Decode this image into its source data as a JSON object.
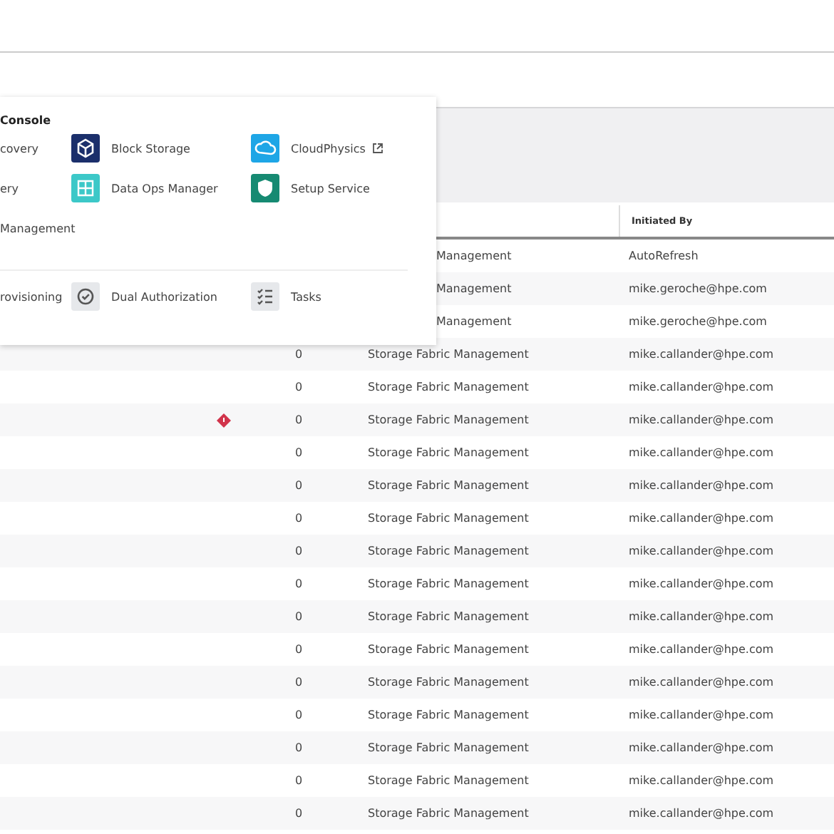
{
  "table": {
    "columns": [
      {
        "label": "Initiated By"
      }
    ],
    "rows": [
      {
        "module": "Management",
        "initiated_by": "AutoRefresh"
      },
      {
        "module": "Management",
        "initiated_by": "mike.geroche@hpe.com"
      },
      {
        "module": "Management",
        "initiated_by": "mike.geroche@hpe.com"
      },
      {
        "count": "0",
        "module": "Storage Fabric Management",
        "initiated_by": "mike.callander@hpe.com"
      },
      {
        "count": "0",
        "module": "Storage Fabric Management",
        "initiated_by": "mike.callander@hpe.com"
      },
      {
        "count": "0",
        "module": "Storage Fabric Management",
        "initiated_by": "mike.callander@hpe.com",
        "alert": true
      },
      {
        "count": "0",
        "module": "Storage Fabric Management",
        "initiated_by": "mike.callander@hpe.com"
      },
      {
        "count": "0",
        "module": "Storage Fabric Management",
        "initiated_by": "mike.callander@hpe.com"
      },
      {
        "count": "0",
        "module": "Storage Fabric Management",
        "initiated_by": "mike.callander@hpe.com"
      },
      {
        "count": "0",
        "module": "Storage Fabric Management",
        "initiated_by": "mike.callander@hpe.com"
      },
      {
        "count": "0",
        "module": "Storage Fabric Management",
        "initiated_by": "mike.callander@hpe.com"
      },
      {
        "count": "0",
        "module": "Storage Fabric Management",
        "initiated_by": "mike.callander@hpe.com"
      },
      {
        "count": "0",
        "module": "Storage Fabric Management",
        "initiated_by": "mike.callander@hpe.com"
      },
      {
        "count": "0",
        "module": "Storage Fabric Management",
        "initiated_by": "mike.callander@hpe.com"
      },
      {
        "count": "0",
        "module": "Storage Fabric Management",
        "initiated_by": "mike.callander@hpe.com"
      },
      {
        "count": "0",
        "module": "Storage Fabric Management",
        "initiated_by": "mike.callander@hpe.com"
      },
      {
        "count": "0",
        "module": "Storage Fabric Management",
        "initiated_by": "mike.callander@hpe.com"
      },
      {
        "count": "0",
        "module": "Storage Fabric Management",
        "initiated_by": "mike.callander@hpe.com"
      }
    ]
  },
  "menu": {
    "title": "Console",
    "sections": [
      {
        "rows": [
          {
            "items": [
              {
                "label": "covery"
              },
              {
                "label": "Block Storage",
                "kind": "cube",
                "color": "#1b2f6b"
              },
              {
                "label": "CloudPhysics",
                "kind": "cloud",
                "color": "#1ea6e6",
                "external": true
              }
            ]
          },
          {
            "items": [
              {
                "label": "ery"
              },
              {
                "label": "Data Ops Manager",
                "kind": "grid",
                "color": "#3cc8c8"
              },
              {
                "label": "Setup Service",
                "kind": "shield",
                "color": "#168a72"
              }
            ]
          },
          {
            "items": [
              {
                "label": "Management"
              }
            ]
          }
        ]
      },
      {
        "rows": [
          {
            "items": [
              {
                "label": "rovisioning"
              },
              {
                "label": "Dual Authorization",
                "kind": "check",
                "color": "#e6e8eb"
              },
              {
                "label": "Tasks",
                "kind": "list",
                "color": "#e6e8eb"
              }
            ]
          }
        ]
      }
    ]
  }
}
